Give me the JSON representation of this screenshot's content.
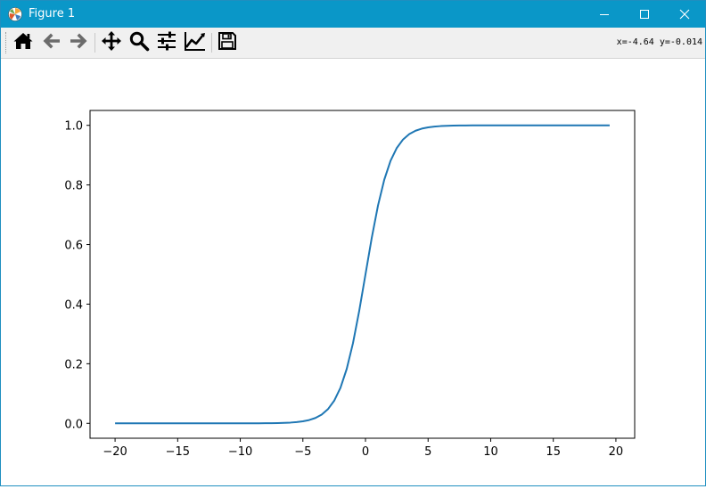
{
  "window": {
    "title": "Figure 1",
    "colors": {
      "titlebar": "#0a97c8",
      "toolbar": "#f0f0f0",
      "line": "#1f77b4"
    }
  },
  "titlebar_icons": [
    "matplotlib-logo-icon",
    "minimize-icon",
    "maximize-icon",
    "close-icon"
  ],
  "toolbar": {
    "buttons": [
      "home-icon",
      "back-icon",
      "forward-icon",
      "pan-icon",
      "zoom-icon",
      "configure-subplots-icon",
      "edit-axis-icon",
      "save-icon"
    ],
    "coordinates": "x=-4.64 y=-0.014"
  },
  "chart_data": {
    "type": "line",
    "title": "",
    "xlabel": "",
    "ylabel": "",
    "xlim": [
      -22.0,
      21.5
    ],
    "ylim": [
      -0.05,
      1.05
    ],
    "xticks": [
      -20,
      -15,
      -10,
      -5,
      0,
      5,
      10,
      15,
      20
    ],
    "xtick_labels": [
      "−20",
      "−15",
      "−10",
      "−5",
      "0",
      "5",
      "10",
      "15",
      "20"
    ],
    "yticks": [
      0.0,
      0.2,
      0.4,
      0.6,
      0.8,
      1.0
    ],
    "ytick_labels": [
      "0.0",
      "0.2",
      "0.4",
      "0.6",
      "0.8",
      "1.0"
    ],
    "grid": false,
    "series": [
      {
        "color": "#1f77b4",
        "x": [
          -20.0,
          -19.5,
          -19.0,
          -18.5,
          -18.0,
          -17.5,
          -17.0,
          -16.5,
          -16.0,
          -15.5,
          -15.0,
          -14.5,
          -14.0,
          -13.5,
          -13.0,
          -12.5,
          -12.0,
          -11.5,
          -11.0,
          -10.5,
          -10.0,
          -9.5,
          -9.0,
          -8.5,
          -8.0,
          -7.5,
          -7.0,
          -6.5,
          -6.0,
          -5.5,
          -5.0,
          -4.5,
          -4.0,
          -3.5,
          -3.0,
          -2.5,
          -2.0,
          -1.5,
          -1.0,
          -0.5,
          0.0,
          0.5,
          1.0,
          1.5,
          2.0,
          2.5,
          3.0,
          3.5,
          4.0,
          4.5,
          5.0,
          5.5,
          6.0,
          6.5,
          7.0,
          7.5,
          8.0,
          8.5,
          9.0,
          9.5,
          10.0,
          10.5,
          11.0,
          11.5,
          12.0,
          12.5,
          13.0,
          13.5,
          14.0,
          14.5,
          15.0,
          15.5,
          16.0,
          16.5,
          17.0,
          17.5,
          18.0,
          18.5,
          19.0,
          19.5
        ],
        "y": [
          0.0,
          0.0,
          0.0,
          0.0,
          0.0,
          0.0,
          0.0,
          0.0,
          0.0,
          0.0,
          0.0,
          0.0,
          0.0,
          0.0,
          0.0,
          0.0,
          0.0,
          0.0,
          0.0,
          0.0,
          0.0,
          0.0001,
          0.0001,
          0.0002,
          0.0003,
          0.0006,
          0.0009,
          0.0015,
          0.0025,
          0.0041,
          0.0067,
          0.011,
          0.018,
          0.0293,
          0.0474,
          0.0759,
          0.1192,
          0.1824,
          0.2689,
          0.3775,
          0.5,
          0.6225,
          0.7311,
          0.8176,
          0.8808,
          0.9241,
          0.9526,
          0.9707,
          0.982,
          0.989,
          0.9933,
          0.9959,
          0.9975,
          0.9985,
          0.9991,
          0.9994,
          0.9997,
          0.9998,
          0.9999,
          0.9999,
          1.0,
          1.0,
          1.0,
          1.0,
          1.0,
          1.0,
          1.0,
          1.0,
          1.0,
          1.0,
          1.0,
          1.0,
          1.0,
          1.0,
          1.0,
          1.0,
          1.0,
          1.0,
          1.0,
          1.0
        ]
      }
    ]
  }
}
